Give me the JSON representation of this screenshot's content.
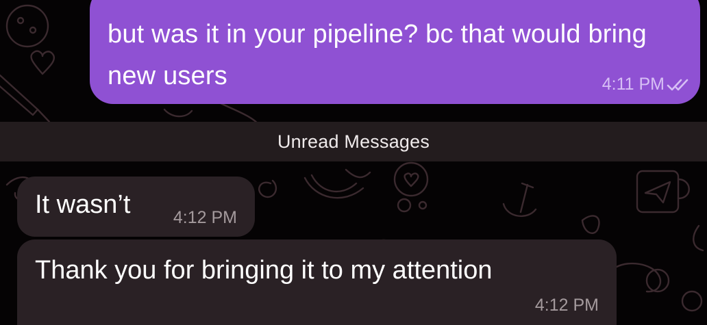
{
  "conversation": {
    "outgoing_message": {
      "text": "but was it in your pipeline? bc that would bring new users",
      "time": "4:11 PM",
      "status_icon": "double-check-read-icon"
    },
    "unread_divider": {
      "label": "Unread Messages"
    },
    "incoming_messages": [
      {
        "text": "It wasn’t",
        "time": "4:12 PM"
      },
      {
        "text": "Thank you for bringing it to my attention",
        "time": "4:12 PM"
      }
    ]
  },
  "colors": {
    "outgoing_bubble": "#8f51d3",
    "incoming_bubble": "#2a2125",
    "divider_bar": "#231c1e",
    "background": "#050304",
    "doodle_stroke": "#3b2a2f"
  },
  "wallpaper_icons": [
    "cookie-icon",
    "heart-icon",
    "knife-icon",
    "banana-icon",
    "anchor-icon",
    "mug-paper-plane-icon",
    "swirl-icon",
    "leaf-icon",
    "bubble-heart-icon"
  ]
}
